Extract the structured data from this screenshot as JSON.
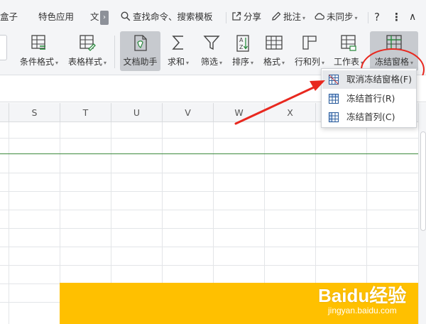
{
  "tabs": [
    {
      "label": "盒子"
    },
    {
      "label": "特色应用"
    },
    {
      "label": "文"
    }
  ],
  "tab_scroll_glyph": "›",
  "topbar": {
    "search_label": "查找命令、搜索模板",
    "share_label": "分享",
    "comment_label": "批注",
    "sync_label": "未同步",
    "help_label": "?",
    "more_label": "⋮",
    "collapse_label": "∧"
  },
  "ribbon": {
    "items": [
      {
        "label": "条件格式",
        "icon": "conditional-format-icon",
        "dropdown": true
      },
      {
        "label": "表格样式",
        "icon": "table-style-icon",
        "dropdown": true
      },
      {
        "label": "文档助手",
        "icon": "doc-assistant-icon",
        "dropdown": false,
        "active": true
      },
      {
        "label": "求和",
        "icon": "sum-icon",
        "dropdown": true
      },
      {
        "label": "筛选",
        "icon": "filter-icon",
        "dropdown": true
      },
      {
        "label": "排序",
        "icon": "sort-icon",
        "dropdown": true
      },
      {
        "label": "格式",
        "icon": "format-icon",
        "dropdown": true
      },
      {
        "label": "行和列",
        "icon": "rows-cols-icon",
        "dropdown": true
      },
      {
        "label": "工作表",
        "icon": "worksheet-icon",
        "dropdown": true
      },
      {
        "label": "冻结窗格",
        "icon": "freeze-panes-icon",
        "dropdown": true,
        "highlighted": true
      }
    ]
  },
  "columns": [
    "S",
    "T",
    "U",
    "V",
    "W",
    "X"
  ],
  "freeze_menu": {
    "items": [
      {
        "label": "取消冻结窗格(F)",
        "icon": "unfreeze-panes-icon",
        "hover": true
      },
      {
        "label": "冻结首行(R)",
        "icon": "freeze-first-row-icon"
      },
      {
        "label": "冻结首列(C)",
        "icon": "freeze-first-col-icon"
      }
    ]
  },
  "colors": {
    "accent_red": "#e8281f",
    "freeze_line": "#3d8b3d",
    "fill_yellow": "#ffc000",
    "toolbar_bg": "#f4f5f7"
  },
  "watermark": {
    "logo": "Baidu经验",
    "url": "jingyan.baidu.com"
  }
}
